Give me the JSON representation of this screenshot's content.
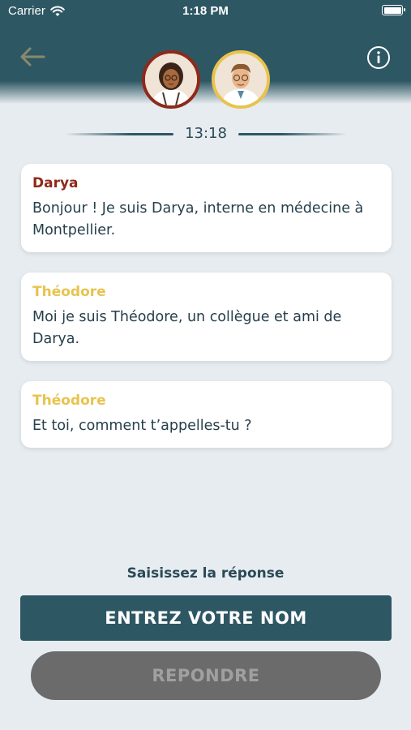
{
  "status_bar": {
    "carrier": "Carrier",
    "time": "1:18 PM"
  },
  "header": {
    "back_icon": "arrow-left-icon",
    "info_icon": "info-icon",
    "avatars": [
      {
        "name": "Darya",
        "border_color": "#8e2a1a"
      },
      {
        "name": "Théodore",
        "border_color": "#e8c34e"
      }
    ]
  },
  "conversation": {
    "timestamp": "13:18",
    "messages": [
      {
        "sender": "Darya",
        "text": "Bonjour ! Je suis Darya, interne en médecine à Montpellier.",
        "color": "#8e2a1a"
      },
      {
        "sender": "Théodore",
        "text": "Moi je suis Théodore, un collègue et ami de Darya.",
        "color": "#e8c34e"
      },
      {
        "sender": "Théodore",
        "text": "Et toi, comment t’appelles-tu ?",
        "color": "#e8c34e"
      }
    ]
  },
  "answer": {
    "prompt": "Saisissez la réponse",
    "name_button": "ENTREZ VOTRE NOM",
    "reply_button": "REPONDRE"
  },
  "colors": {
    "primary": "#2e5764",
    "background": "#e7ecf0",
    "disabled": "#6b6b6b"
  }
}
